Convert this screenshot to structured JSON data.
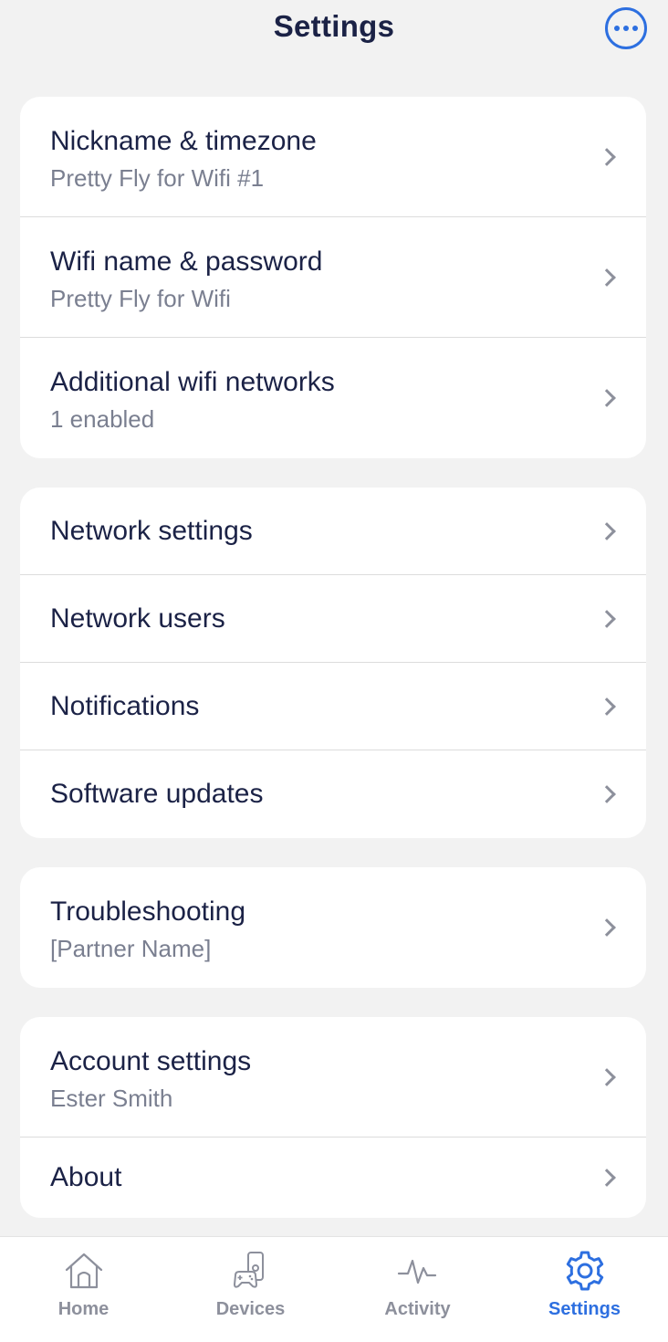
{
  "header": {
    "title": "Settings",
    "more_icon": "more-horizontal-icon"
  },
  "colors": {
    "accent": "#2d6fe0",
    "text": "#1b2246",
    "subtext": "#7a7f90",
    "background": "#f2f2f2"
  },
  "groups": [
    {
      "items": [
        {
          "label": "Nickname & timezone",
          "sub": "Pretty Fly for Wifi #1"
        },
        {
          "label": "Wifi name & password",
          "sub": "Pretty Fly for Wifi"
        },
        {
          "label": "Additional wifi networks",
          "sub": "1 enabled"
        }
      ]
    },
    {
      "items": [
        {
          "label": "Network settings"
        },
        {
          "label": "Network users"
        },
        {
          "label": "Notifications"
        },
        {
          "label": "Software updates"
        }
      ]
    },
    {
      "items": [
        {
          "label": "Troubleshooting",
          "sub": "[Partner Name]"
        }
      ]
    },
    {
      "items": [
        {
          "label": "Account settings",
          "sub": "Ester Smith"
        },
        {
          "label": "About"
        }
      ]
    }
  ],
  "tabbar": {
    "tabs": [
      {
        "label": "Home",
        "icon": "home-icon",
        "active": false
      },
      {
        "label": "Devices",
        "icon": "devices-icon",
        "active": false
      },
      {
        "label": "Activity",
        "icon": "activity-icon",
        "active": false
      },
      {
        "label": "Settings",
        "icon": "gear-icon",
        "active": true
      }
    ]
  }
}
